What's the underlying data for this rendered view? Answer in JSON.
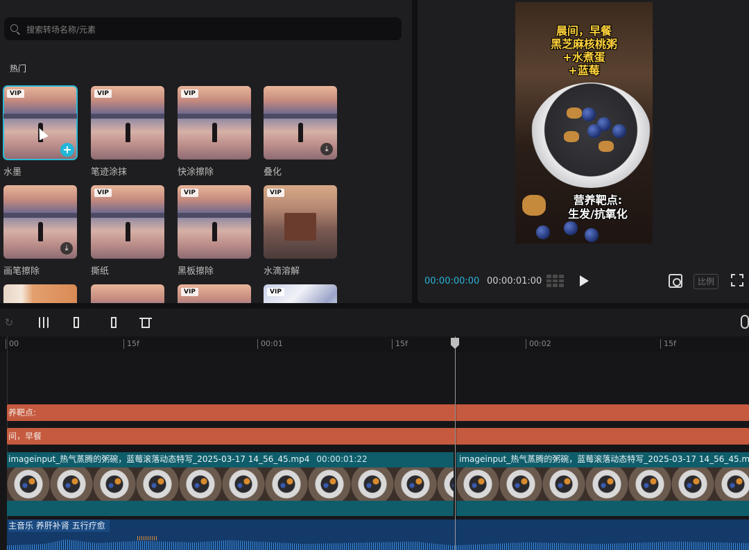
{
  "search": {
    "placeholder": "搜索转场名称/元素",
    "value": ""
  },
  "section": {
    "title": "热门"
  },
  "transitions": [
    {
      "label": "水墨",
      "vip": "VIP",
      "state": "selected",
      "icon": "add-icon"
    },
    {
      "label": "笔迹涂抹",
      "vip": "VIP",
      "state": "normal"
    },
    {
      "label": "快涂擦除",
      "vip": "VIP",
      "state": "normal"
    },
    {
      "label": "叠化",
      "vip": "",
      "state": "download",
      "icon": "download-icon"
    },
    {
      "label": "画笔擦除",
      "vip": "",
      "state": "download",
      "icon": "download-icon"
    },
    {
      "label": "撕纸",
      "vip": "VIP",
      "state": "normal"
    },
    {
      "label": "黑板擦除",
      "vip": "VIP",
      "state": "normal"
    },
    {
      "label": "水滴溶解",
      "vip": "VIP",
      "state": "normal"
    },
    {
      "label": "",
      "vip": "",
      "state": "partial"
    },
    {
      "label": "",
      "vip": "",
      "state": "partial"
    },
    {
      "label": "",
      "vip": "VIP",
      "state": "partial"
    },
    {
      "label": "",
      "vip": "VIP",
      "state": "partial"
    }
  ],
  "preview": {
    "overlay_top": [
      "晨间，早餐",
      "黑芝麻核桃粥",
      "+水煮蛋",
      "+蓝莓"
    ],
    "overlay_bottom": [
      "营养靶点:",
      "生发/抗氧化"
    ],
    "timecode_current": "00:00:00:00",
    "timecode_total": "00:00:01:00",
    "ratio_label": "比例"
  },
  "ruler": {
    "ticks": [
      "00",
      "15f",
      "00:01",
      "15f",
      "00:02",
      "15f"
    ]
  },
  "tracks": {
    "text_track_1": "养靶点:",
    "text_track_2": "间，早餐",
    "video_clip_1": {
      "name": "imageinput_热气蒸腾的粥碗，蓝莓滚落动态特写_2025-03-17 14_56_45.mp4",
      "duration": "00:00:01:22"
    },
    "video_clip_2": {
      "name": "imageinput_热气蒸腾的粥碗，蓝莓滚落动态特写_2025-03-17 14_56_45.mp4"
    },
    "audio": "主音乐 养肝补肾 五行疗愈"
  },
  "colors": {
    "accent": "#22b6d8",
    "text_track": "#c55a3e",
    "video_track": "#0f5d6b",
    "audio_track": "#143a6a"
  }
}
